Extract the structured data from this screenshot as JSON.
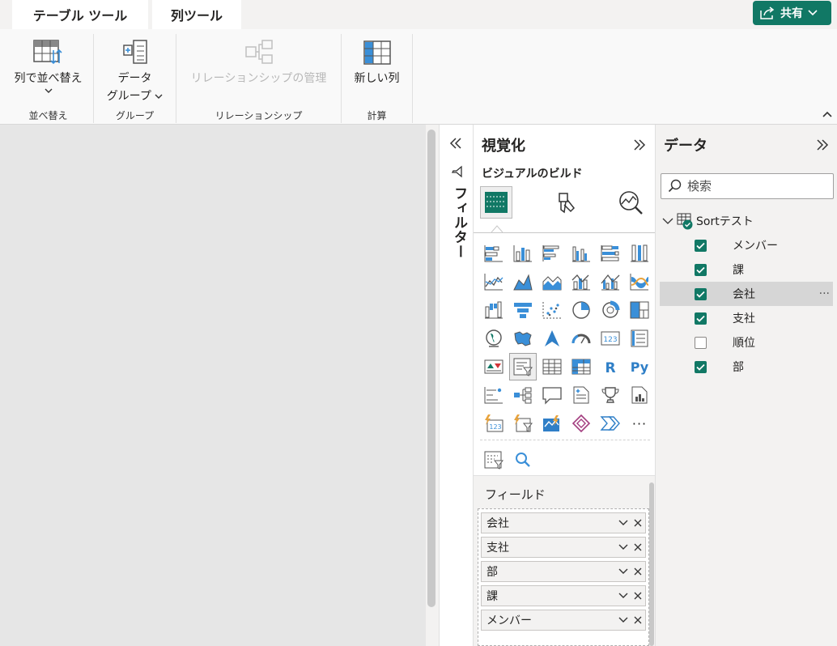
{
  "tabs": [
    {
      "label": "テーブル ツール",
      "active": false
    },
    {
      "label": "列ツール",
      "active": true
    }
  ],
  "share": {
    "label": "共有"
  },
  "ribbon": {
    "sort": {
      "label": "列で並べ替え",
      "group": "並べ替え"
    },
    "data_group": {
      "label_line1": "データ",
      "label_line2": "グループ",
      "group": "グループ"
    },
    "relationship": {
      "label": "リレーションシップの管理",
      "group": "リレーションシップ"
    },
    "new_column": {
      "label": "新しい列",
      "group": "計算"
    }
  },
  "filters": {
    "title": "フィルター"
  },
  "visualizations": {
    "title": "視覚化",
    "subtitle": "ビジュアルのビルド",
    "more_label": "···",
    "fields_label": "フィールド",
    "field_wells": [
      "会社",
      "支社",
      "部",
      "課",
      "メンバー"
    ]
  },
  "data": {
    "title": "データ",
    "search_placeholder": "検索",
    "table": "Sortテスト",
    "fields": [
      {
        "name": "メンバー",
        "checked": true
      },
      {
        "name": "課",
        "checked": true
      },
      {
        "name": "会社",
        "checked": true
      },
      {
        "name": "支社",
        "checked": true
      },
      {
        "name": "順位",
        "checked": false
      },
      {
        "name": "部",
        "checked": true
      }
    ],
    "more_label": "···"
  },
  "colors": {
    "accent": "#117865",
    "blue": "#3a8fd8",
    "gray": "#505050"
  }
}
